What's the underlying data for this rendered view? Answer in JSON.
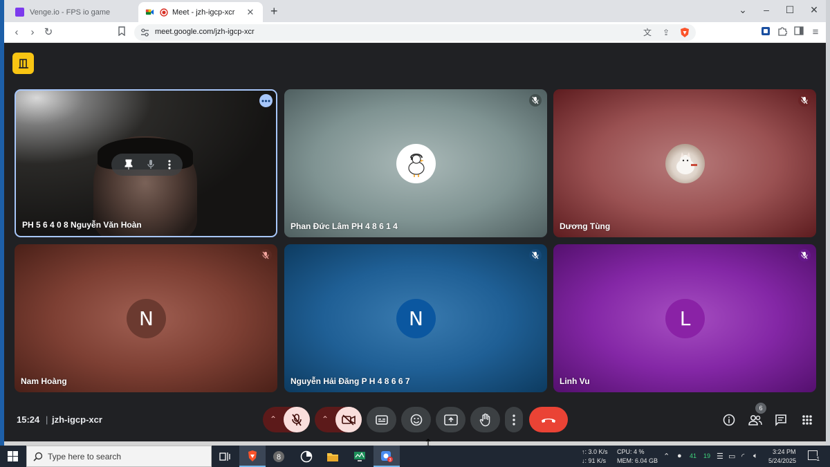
{
  "browser": {
    "tabs": [
      {
        "label": "Venge.io - FPS io game",
        "favicon_color": "#7c3aed",
        "active": false
      },
      {
        "label": "Meet - jzh-igcp-xcr",
        "favicon_color": "#00832d",
        "active": true
      }
    ],
    "url": "meet.google.com/jzh-igcp-xcr",
    "tab_close": "✕",
    "new_tab": "+"
  },
  "meet": {
    "time": "15:24",
    "separator": "|",
    "meeting_code": "jzh-igcp-xcr",
    "participant_count": "6",
    "colors": {
      "end_call": "#ea4335",
      "active_frame": "#a8c7fa",
      "badge": "#f9c513"
    },
    "tiles": [
      {
        "name": "PH 5 6 4 0 8 Nguyễn Văn Hoàn",
        "muted": false,
        "type": "video"
      },
      {
        "name": "Phan Đức Lâm PH 4 8 6 1 4",
        "muted": true,
        "type": "avatar-duck"
      },
      {
        "name": "Dương Tùng",
        "muted": true,
        "type": "avatar-cat"
      },
      {
        "name": "Nam Hoàng",
        "muted": true,
        "type": "letter",
        "initial": "N",
        "avatar_color": "#6b3a30"
      },
      {
        "name": "Nguyễn Hải Đăng P H 4 8 6 6 7",
        "muted": true,
        "type": "letter",
        "initial": "N",
        "avatar_color": "#0b57a0"
      },
      {
        "name": "Linh Vu",
        "muted": true,
        "type": "letter",
        "initial": "L",
        "avatar_color": "#8a22a6"
      }
    ]
  },
  "taskbar": {
    "search_placeholder": "Type here to search",
    "net_up": "↑: 3.0 K/s",
    "net_down": "↓: 91 K/s",
    "cpu": "CPU: 4 %",
    "mem": "MEM: 6.04 GB",
    "temp1": "41",
    "temp2": "19",
    "clock_time": "3:24 PM",
    "clock_date": "5/24/2025",
    "meet_badge": "3",
    "notif_count": "1"
  }
}
